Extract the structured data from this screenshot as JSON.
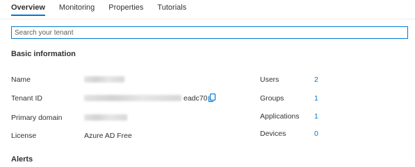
{
  "tabs": [
    {
      "label": "Overview",
      "active": true
    },
    {
      "label": "Monitoring",
      "active": false
    },
    {
      "label": "Properties",
      "active": false
    },
    {
      "label": "Tutorials",
      "active": false
    }
  ],
  "search": {
    "placeholder": "Search your tenant",
    "value": ""
  },
  "basic_info": {
    "title": "Basic information",
    "rows": [
      {
        "label": "Name",
        "value": ""
      },
      {
        "label": "Tenant ID",
        "value_suffix": "eadc70"
      },
      {
        "label": "Primary domain",
        "value": ""
      },
      {
        "label": "License",
        "value": "Azure AD Free"
      }
    ]
  },
  "stats": [
    {
      "label": "Users",
      "value": "2"
    },
    {
      "label": "Groups",
      "value": "1"
    },
    {
      "label": "Applications",
      "value": "1"
    },
    {
      "label": "Devices",
      "value": "0"
    }
  ],
  "alerts": {
    "title": "Alerts"
  },
  "icons": {
    "copy": "copy-icon"
  },
  "colors": {
    "accent": "#0078d4",
    "text": "#323130"
  }
}
